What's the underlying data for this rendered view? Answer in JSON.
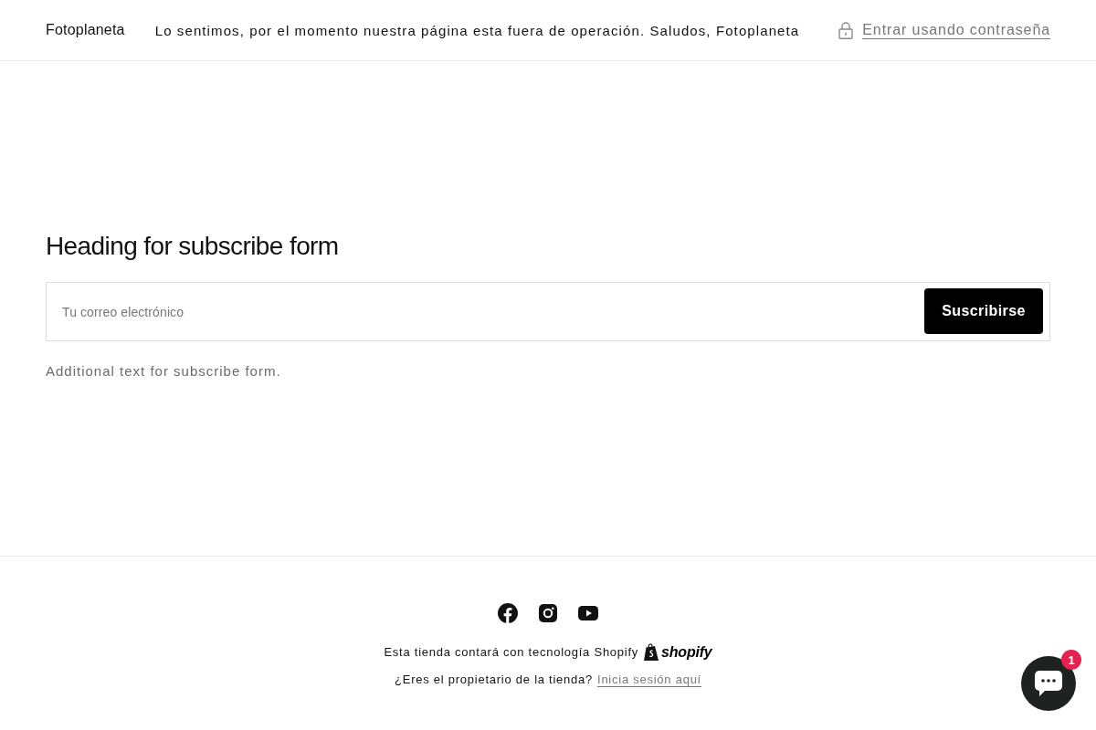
{
  "header": {
    "brand": "Fotoplaneta",
    "message": "Lo sentimos, por el momento nuestra página esta fuera de operación. Saludos, Fotoplaneta",
    "password_link": "Entrar usando contraseña"
  },
  "newsletter": {
    "heading": "Heading for subscribe form",
    "email_field": {
      "placeholder": "Tu correo electrónico"
    },
    "submit_button": "Suscribirse",
    "note": "Additional text for subscribe form."
  },
  "footer": {
    "social_links": [
      {
        "kind": "facebook"
      },
      {
        "kind": "instagram"
      },
      {
        "kind": "youtube"
      }
    ],
    "powered_by": {
      "text": "Esta tienda contará con tecnología Shopify",
      "logo_text": "shopify"
    },
    "owner_prompt": "¿Eres el propietario de la tienda?",
    "login_link": "Inicia sesión aquí"
  },
  "chat_launcher": {
    "unread_count": "1"
  }
}
